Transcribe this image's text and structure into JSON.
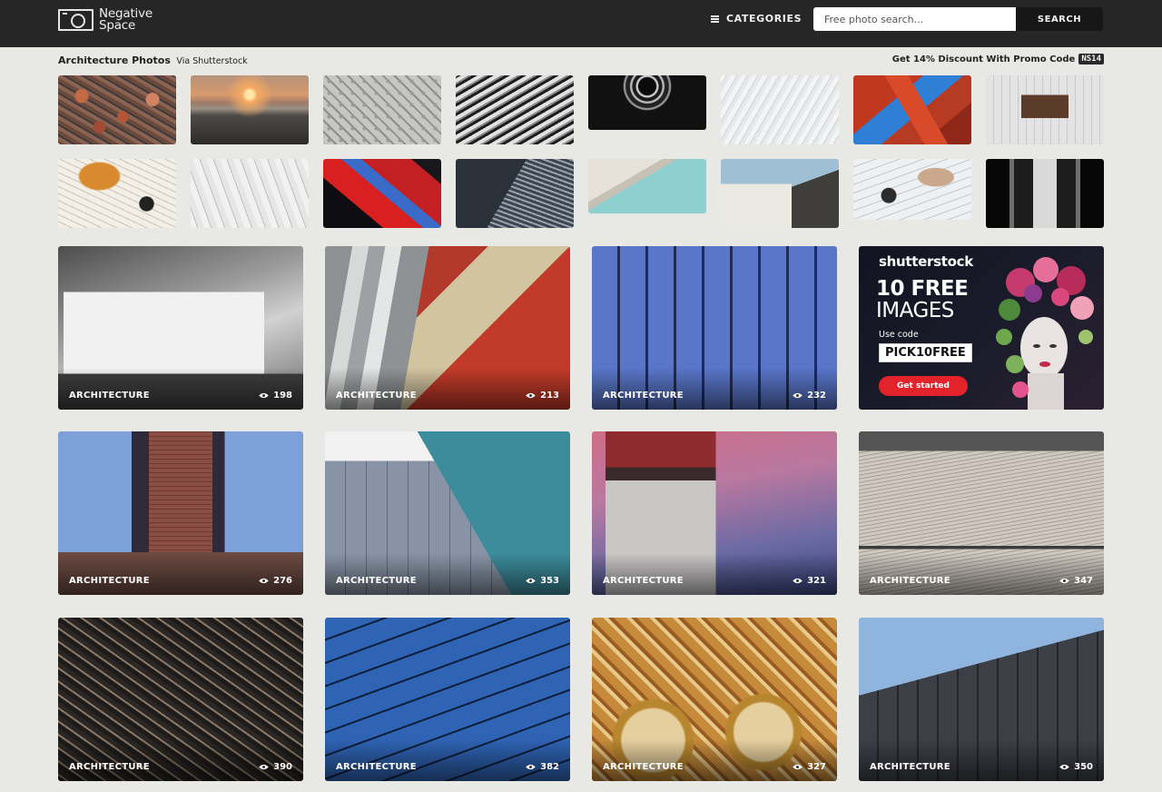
{
  "header": {
    "logo_line1": "Negative",
    "logo_line2": "Space",
    "categories_label": "CATEGORIES",
    "search_placeholder": "Free photo search...",
    "search_button": "SEARCH"
  },
  "subheader": {
    "title": "Architecture Photos",
    "via": "Via Shutterstock",
    "promo_text": "Get 14% Discount With Promo Code",
    "promo_code": "NS14"
  },
  "thumbnails": [
    "aerial-city-rooftops",
    "sunset-river-city",
    "geometric-tile-pattern",
    "striped-building-facade",
    "spiral-building-looking-up",
    "white-curved-lines",
    "red-blue-abstract-building",
    "architecture-model-in-hand",
    "hands-drawing-plans",
    "white-blueprints",
    "red-glass-building",
    "glass-skyscrapers-looking-up",
    "white-building-teal-sky",
    "white-block-blue-sky",
    "architects-drawing-table",
    "dark-corridor"
  ],
  "cards": [
    {
      "category": "ARCHITECTURE",
      "views": "198"
    },
    {
      "category": "ARCHITECTURE",
      "views": "213"
    },
    {
      "category": "ARCHITECTURE",
      "views": "232"
    },
    {
      "category": "ARCHITECTURE",
      "views": "276"
    },
    {
      "category": "ARCHITECTURE",
      "views": "353"
    },
    {
      "category": "ARCHITECTURE",
      "views": "321"
    },
    {
      "category": "ARCHITECTURE",
      "views": "347"
    },
    {
      "category": "ARCHITECTURE",
      "views": "390"
    },
    {
      "category": "ARCHITECTURE",
      "views": "382"
    },
    {
      "category": "ARCHITECTURE",
      "views": "327"
    },
    {
      "category": "ARCHITECTURE",
      "views": "350"
    }
  ],
  "ad": {
    "brand": "shutterstock",
    "headline1": "10 FREE",
    "headline2": "IMAGES",
    "use_code": "Use code",
    "code": "PICK10FREE",
    "cta": "Get started"
  },
  "icons": {
    "menu": "hamburger-icon",
    "views": "eye-icon",
    "logo": "camera-frame-icon"
  },
  "colors": {
    "header_bg": "#262626",
    "page_bg": "#e8e8e5",
    "ad_cta": "#e3232b"
  }
}
